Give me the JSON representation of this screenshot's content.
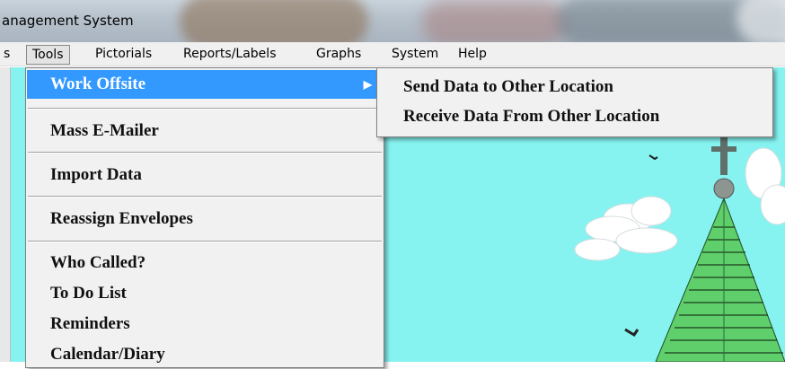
{
  "window": {
    "title": "anagement System"
  },
  "menubar": {
    "items": [
      {
        "label": "s"
      },
      {
        "label": "Tools"
      },
      {
        "label": "Pictorials"
      },
      {
        "label": "Reports/Labels"
      },
      {
        "label": "Graphs"
      },
      {
        "label": "System"
      },
      {
        "label": "Help"
      }
    ]
  },
  "tools_menu": {
    "items": [
      {
        "label": "Work Offsite",
        "selected": true,
        "has_submenu": true
      },
      {
        "label": "Mass E-Mailer"
      },
      {
        "label": "Import Data"
      },
      {
        "label": "Reassign Envelopes"
      },
      {
        "label": "Who Called?"
      },
      {
        "label": "To Do List"
      },
      {
        "label": "Reminders"
      },
      {
        "label": "Calendar/Diary"
      }
    ],
    "submenu_arrow": "▶"
  },
  "submenu": {
    "items": [
      {
        "label": "Send Data to Other Location"
      },
      {
        "label": "Receive Data From Other Location"
      }
    ]
  },
  "colors": {
    "selection": "#3399ff",
    "sky": "#86f3f0",
    "steeple_green": "#5fcf6b"
  }
}
